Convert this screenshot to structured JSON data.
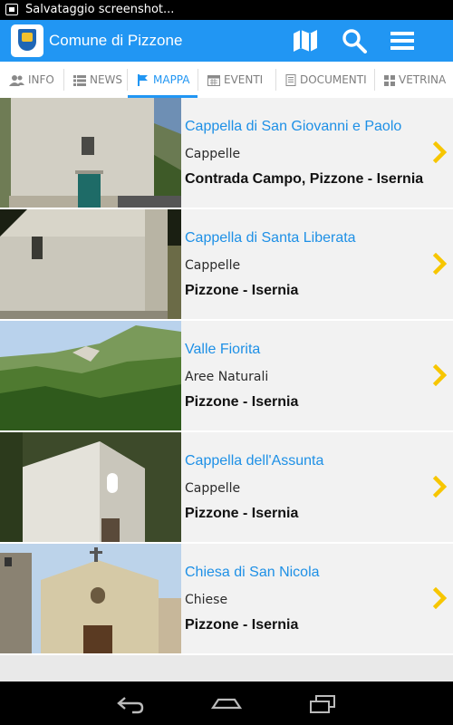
{
  "status_bar": {
    "text": "Salvataggio screenshot..."
  },
  "app_bar": {
    "title": "Comune di Pizzone",
    "icons": [
      "map-icon",
      "search-icon",
      "menu-icon"
    ]
  },
  "tabs": [
    {
      "label": "INFO",
      "icon": "people-icon"
    },
    {
      "label": "NEWS",
      "icon": "list-icon"
    },
    {
      "label": "MAPPA",
      "icon": "map-pin-icon",
      "active": true
    },
    {
      "label": "EVENTI",
      "icon": "calendar-icon"
    },
    {
      "label": "DOCUMENTI",
      "icon": "document-icon"
    },
    {
      "label": "VETRINA",
      "icon": "grid-icon"
    }
  ],
  "places": [
    {
      "name": "Cappella di San Giovanni e Paolo",
      "category": "Cappelle",
      "location": "Contrada Campo, Pizzone - Isernia"
    },
    {
      "name": "Cappella di Santa Liberata",
      "category": "Cappelle",
      "location": "Pizzone - Isernia"
    },
    {
      "name": "Valle Fiorita",
      "category": "Aree Naturali",
      "location": "Pizzone - Isernia"
    },
    {
      "name": "Cappella dell'Assunta",
      "category": "Cappelle",
      "location": "Pizzone - Isernia"
    },
    {
      "name": "Chiesa di San Nicola",
      "category": "Chiese",
      "location": "Pizzone - Isernia"
    }
  ],
  "colors": {
    "accent": "#2196f3",
    "chevron": "#f7c600",
    "title": "#1e90e6"
  }
}
